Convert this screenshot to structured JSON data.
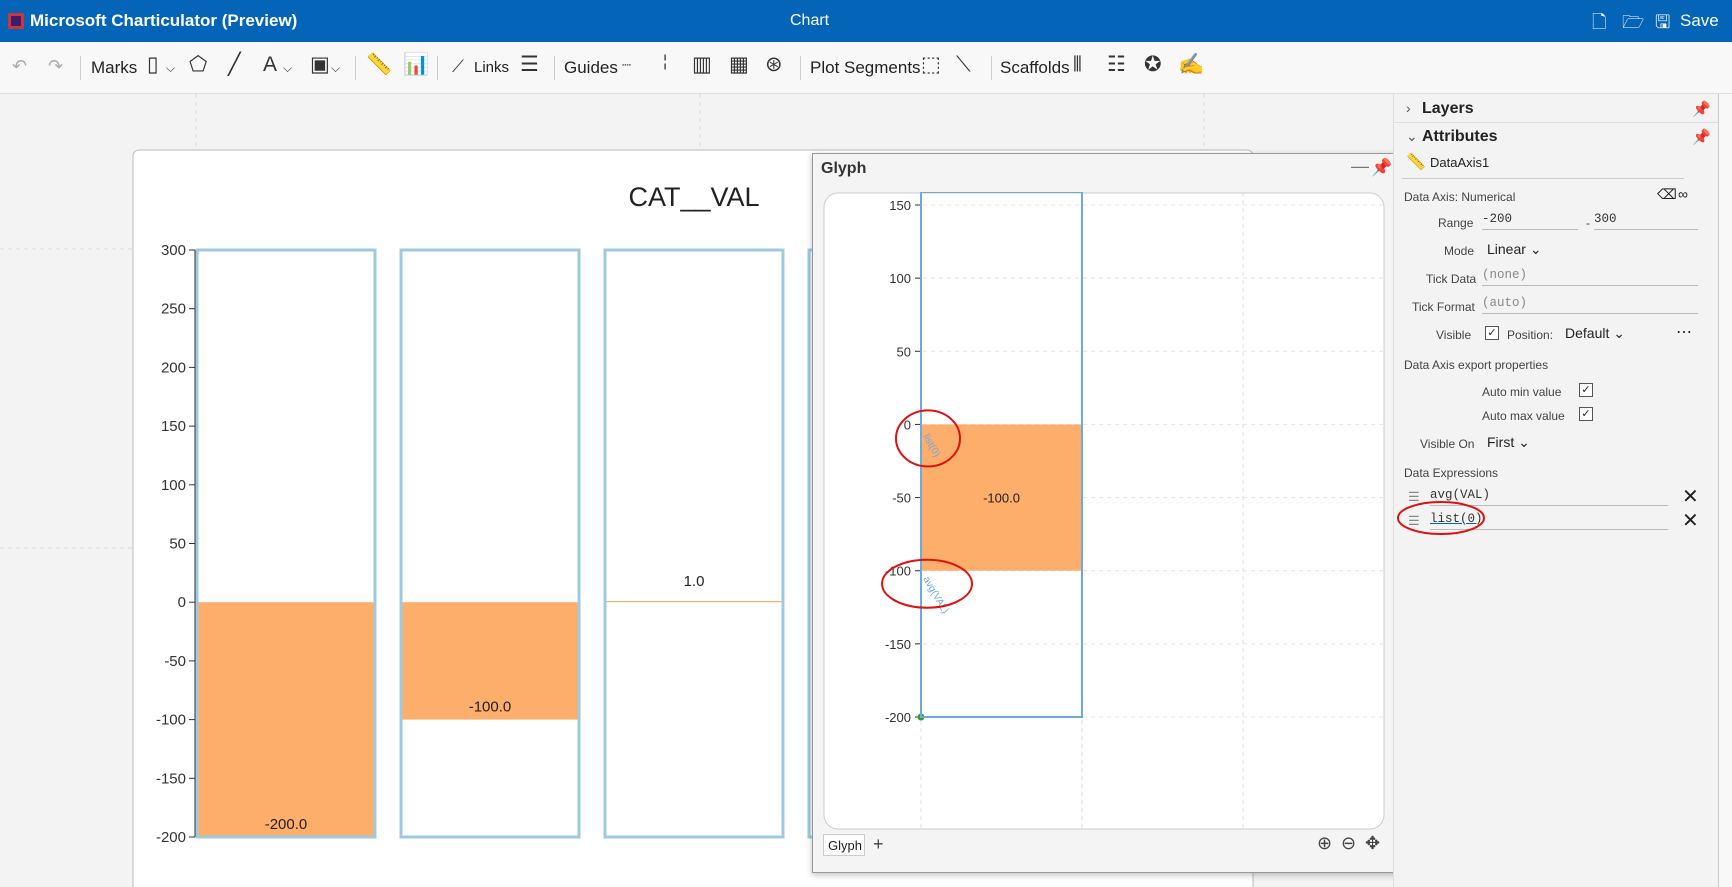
{
  "titlebar": {
    "app_title": "Microsoft Charticulator (Preview)",
    "doc_title": "Chart",
    "save_label": "Save",
    "icons": [
      "new-file-icon",
      "open-folder-icon",
      "save-icon"
    ]
  },
  "toolbar": {
    "marks": "Marks",
    "links": "Links",
    "guides": "Guides",
    "plot_segments": "Plot Segments",
    "scaffolds": "Scaffolds"
  },
  "chart_data": [
    {
      "type": "bar",
      "title": "CAT__VAL",
      "categories": [
        "",
        "",
        "",
        ""
      ],
      "values": [
        -200,
        -100,
        1,
        null
      ],
      "data_labels": [
        "-200.0",
        "-100.0",
        "1.0",
        ""
      ],
      "y_ticks": [
        "300",
        "250",
        "200",
        "150",
        "100",
        "50",
        "0",
        "-50",
        "-100",
        "-150",
        "-200"
      ],
      "ylim": [
        -200,
        300
      ],
      "bar_color": "#fcae6a",
      "frame_color": "#9ecae1"
    },
    {
      "type": "bar",
      "values": [
        -100
      ],
      "data_labels": [
        "-100.0"
      ],
      "y_ticks": [
        "150",
        "100",
        "50",
        "0",
        "-50",
        "-100",
        "-150",
        "-200"
      ],
      "ylim": [
        -200,
        150
      ],
      "axis_annotations": [
        "list(0)",
        "avg(VAL)"
      ]
    }
  ],
  "glyph_panel": {
    "title": "Glyph",
    "tab_label": "Glyph"
  },
  "layers": {
    "header": "Layers"
  },
  "attributes": {
    "header": "Attributes",
    "object_name": "DataAxis1",
    "section_title": "Data Axis: Numerical",
    "range_label": "Range",
    "range_min": "-200",
    "range_sep": "-",
    "range_max": "300",
    "mode_label": "Mode",
    "mode_value": "Linear",
    "tick_data_label": "Tick Data",
    "tick_data_value": "(none)",
    "tick_format_label": "Tick Format",
    "tick_format_value": "(auto)",
    "visible_label": "Visible",
    "visible_checked": "✓",
    "position_label": "Position:",
    "position_value": "Default",
    "more_icon": "⋯",
    "export_title": "Data Axis export properties",
    "auto_min_label": "Auto min value",
    "auto_min_checked": "✓",
    "auto_max_label": "Auto max value",
    "auto_max_checked": "✓",
    "visible_on_label": "Visible On",
    "visible_on_value": "First",
    "expressions_title": "Data Expressions",
    "expressions": [
      "avg(VAL)",
      "list(0)"
    ]
  },
  "annotation_color": "#e01010",
  "accent": "#0364b8"
}
